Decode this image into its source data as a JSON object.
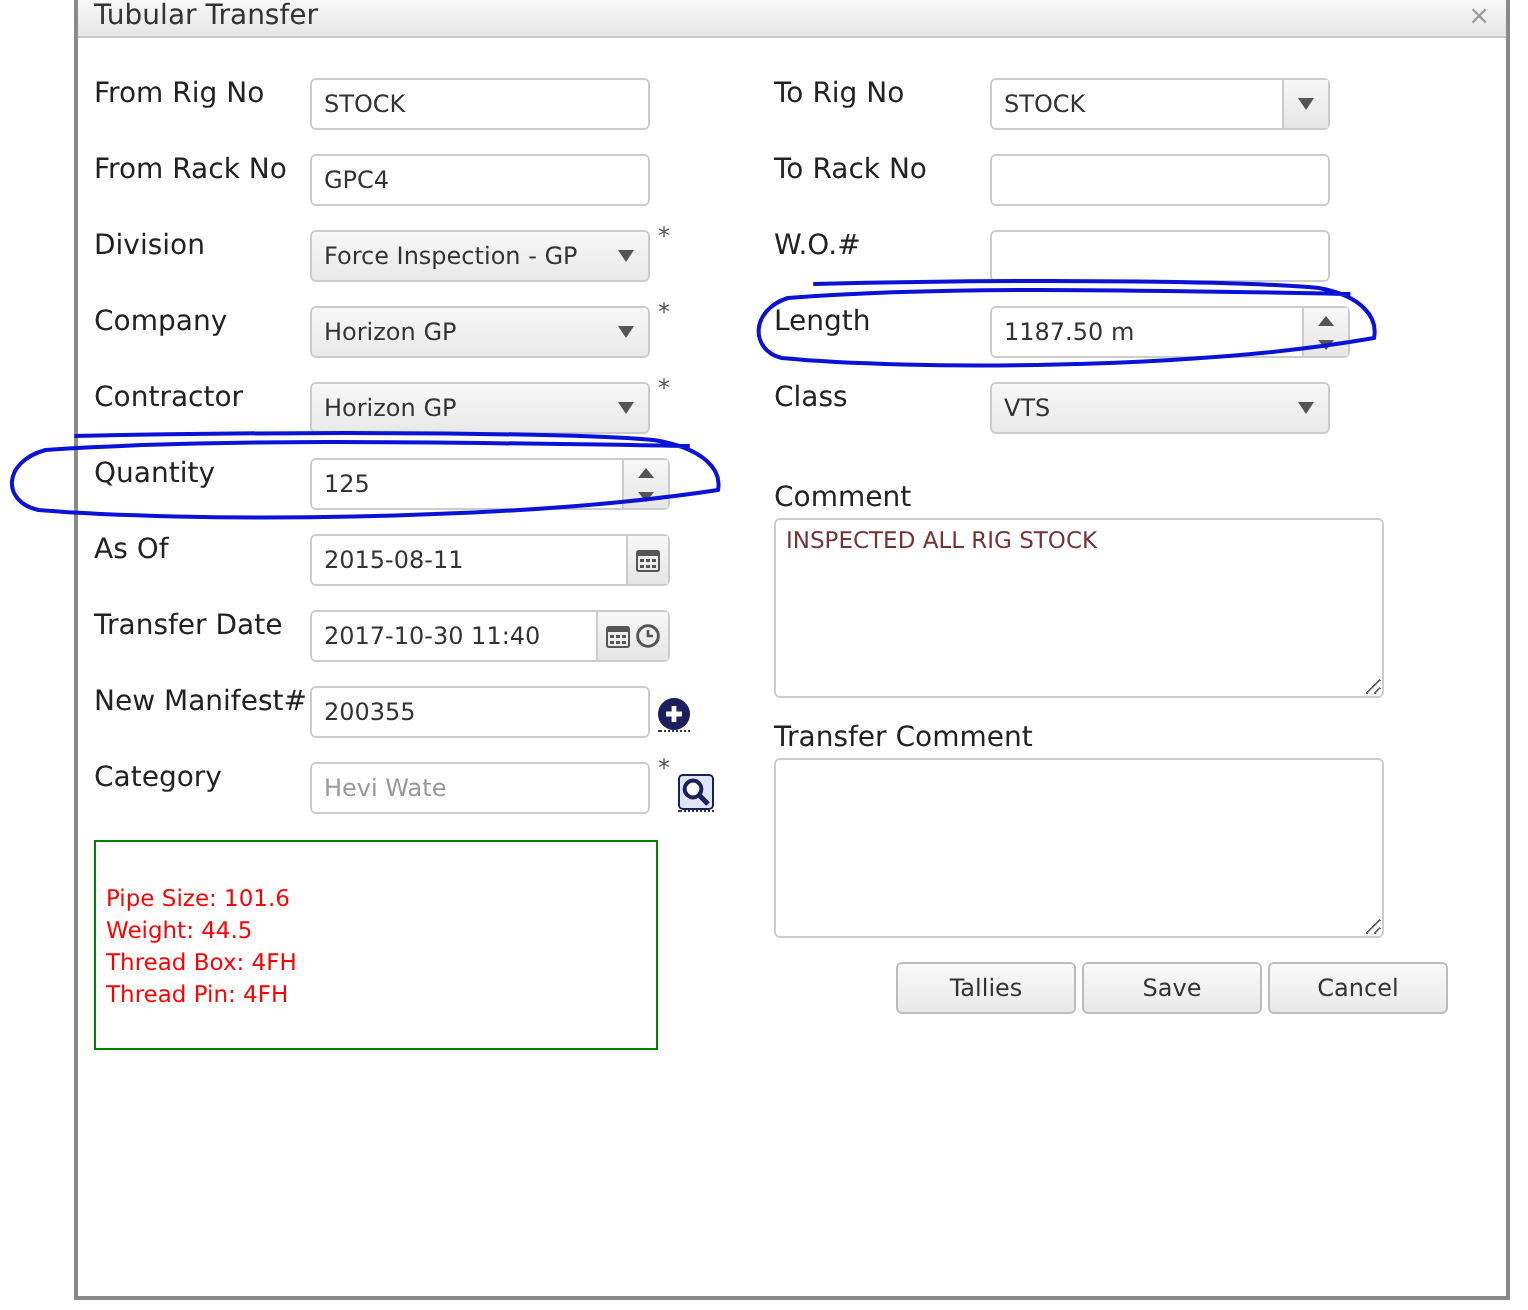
{
  "window": {
    "title": "Tubular Transfer",
    "close": "×"
  },
  "left_fields": [
    {
      "label": "From Rig No",
      "kind": "text",
      "value": "STOCK",
      "circled": false
    },
    {
      "label": "From Rack No",
      "kind": "text",
      "value": "GPC4",
      "circled": false
    },
    {
      "label": "Division",
      "kind": "select",
      "value": "Force Inspection - GP",
      "required_mark": "*",
      "circled": false
    },
    {
      "label": "Company",
      "kind": "select",
      "value": "Horizon GP",
      "required_mark": "*",
      "circled": false
    },
    {
      "label": "Contractor",
      "kind": "select",
      "value": "Horizon GP",
      "required_mark": "*",
      "circled": false
    },
    {
      "label": "Quantity",
      "kind": "number",
      "value": "125",
      "circled": true
    },
    {
      "label": "As Of",
      "kind": "date",
      "value": "2015-08-11",
      "circled": false
    },
    {
      "label": "Transfer Date",
      "kind": "datetime",
      "value": "2017-10-30 11:40",
      "circled": false
    },
    {
      "label": "New Manifest#",
      "kind": "add",
      "value": "200355",
      "circled": false
    },
    {
      "label": "Category",
      "kind": "lookup",
      "placeholder": "Hevi Wate",
      "required_mark": "*",
      "circled": false
    }
  ],
  "info_box": [
    "Pipe Size: 101.6",
    "Weight: 44.5",
    "Thread Box: 4FH",
    "Thread Pin: 4FH"
  ],
  "right_fields": [
    {
      "label": "To Rig No",
      "kind": "combo",
      "value": "STOCK",
      "circled": false
    },
    {
      "label": "To Rack No",
      "kind": "text",
      "circled": false
    },
    {
      "label": "W.O.#",
      "kind": "text",
      "circled": false
    },
    {
      "label": "Length",
      "kind": "number",
      "value": "1187.50 m",
      "circled": true
    },
    {
      "label": "Class",
      "kind": "select",
      "value": "VTS",
      "circled": false
    }
  ],
  "comments": [
    {
      "label": "Comment",
      "value": "INSPECTED ALL RIG STOCK"
    },
    {
      "label": "Transfer Comment"
    }
  ],
  "buttons": [
    "Tallies",
    "Save",
    "Cancel"
  ]
}
